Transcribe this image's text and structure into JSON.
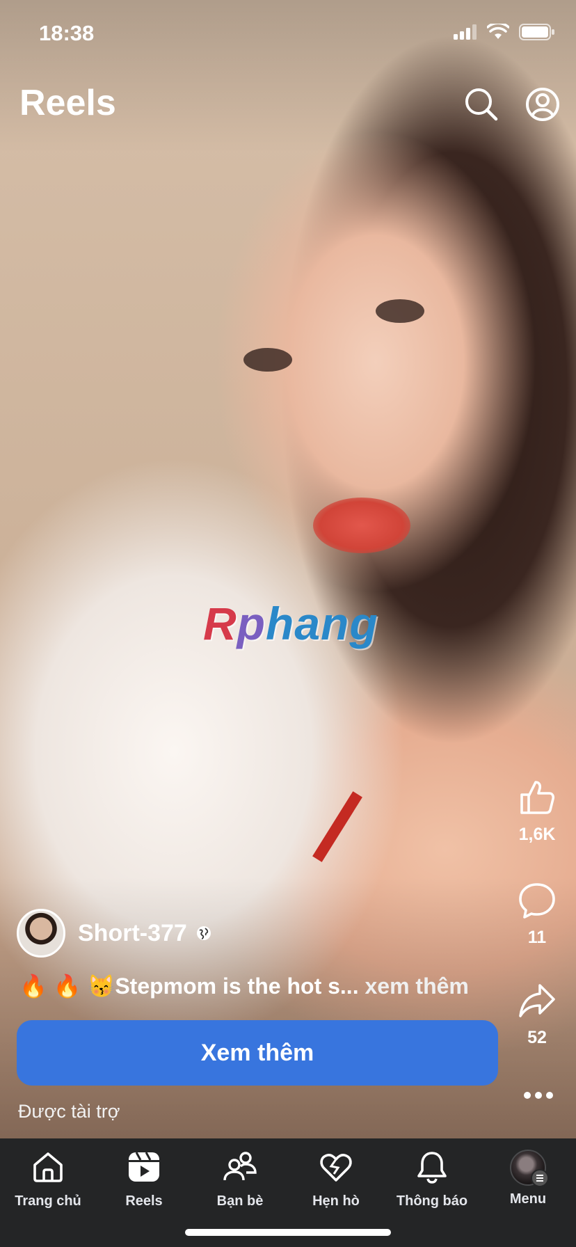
{
  "status_bar": {
    "time": "18:38"
  },
  "header": {
    "title": "Reels"
  },
  "watermark": {
    "part1": "R",
    "part2": "p",
    "part3": "hang"
  },
  "actions": {
    "like_count": "1,6K",
    "comment_count": "11",
    "share_count": "52"
  },
  "post": {
    "author": "Short-377",
    "caption": "🔥 🔥 😽Stepmom is the hot s...",
    "caption_more": "xem thêm",
    "cta_label": "Xem thêm",
    "sponsored_label": "Được tài trợ"
  },
  "tabbar": {
    "tabs": [
      {
        "label": "Trang chủ",
        "icon": "home-icon"
      },
      {
        "label": "Reels",
        "icon": "reels-icon",
        "active": true
      },
      {
        "label": "Bạn bè",
        "icon": "friends-icon"
      },
      {
        "label": "Hẹn hò",
        "icon": "dating-heart-icon"
      },
      {
        "label": "Thông báo",
        "icon": "bell-icon"
      },
      {
        "label": "Menu",
        "icon": "profile-avatar"
      }
    ]
  },
  "colors": {
    "cta": "#3875de",
    "tabbar": "#242526"
  }
}
